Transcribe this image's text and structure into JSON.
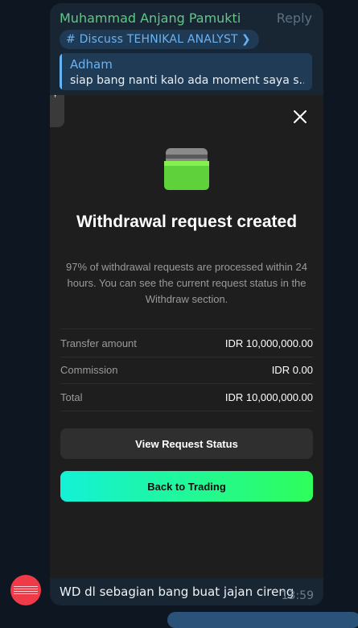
{
  "message": {
    "sender": "Muhammad Anjang Pamukti",
    "reply_label": "Reply",
    "topic": "# Discuss TEHNIKAL ANALYST",
    "topic_chevron": "❯",
    "quote": {
      "author": "Adham",
      "text": "siap bang nanti kalo ada moment saya s..."
    },
    "text": "WD dl sebagian bang buat jajan cireng",
    "time": "13:59"
  },
  "screenshot": {
    "corner_glyph": "’",
    "title": "Withdrawal request created",
    "description": "97% of withdrawal requests are processed within 24 hours. You can see the current request status in the Withdraw section.",
    "rows": [
      {
        "label": "Transfer amount",
        "value": "IDR 10,000,000.00"
      },
      {
        "label": "Commission",
        "value": "IDR 0.00"
      },
      {
        "label": "Total",
        "value": "IDR 10,000,000.00"
      }
    ],
    "view_button": "View Request Status",
    "back_button": "Back to Trading"
  },
  "colors": {
    "background": "#0e1621",
    "bubble": "#182533",
    "sender": "#5fc984",
    "link": "#6ab3f3",
    "gradient_start": "#13f1d6",
    "gradient_end": "#2ffe5b"
  },
  "icons": {
    "close": "close-icon",
    "wallet": "wallet-card-icon",
    "avatar": "avatar"
  }
}
